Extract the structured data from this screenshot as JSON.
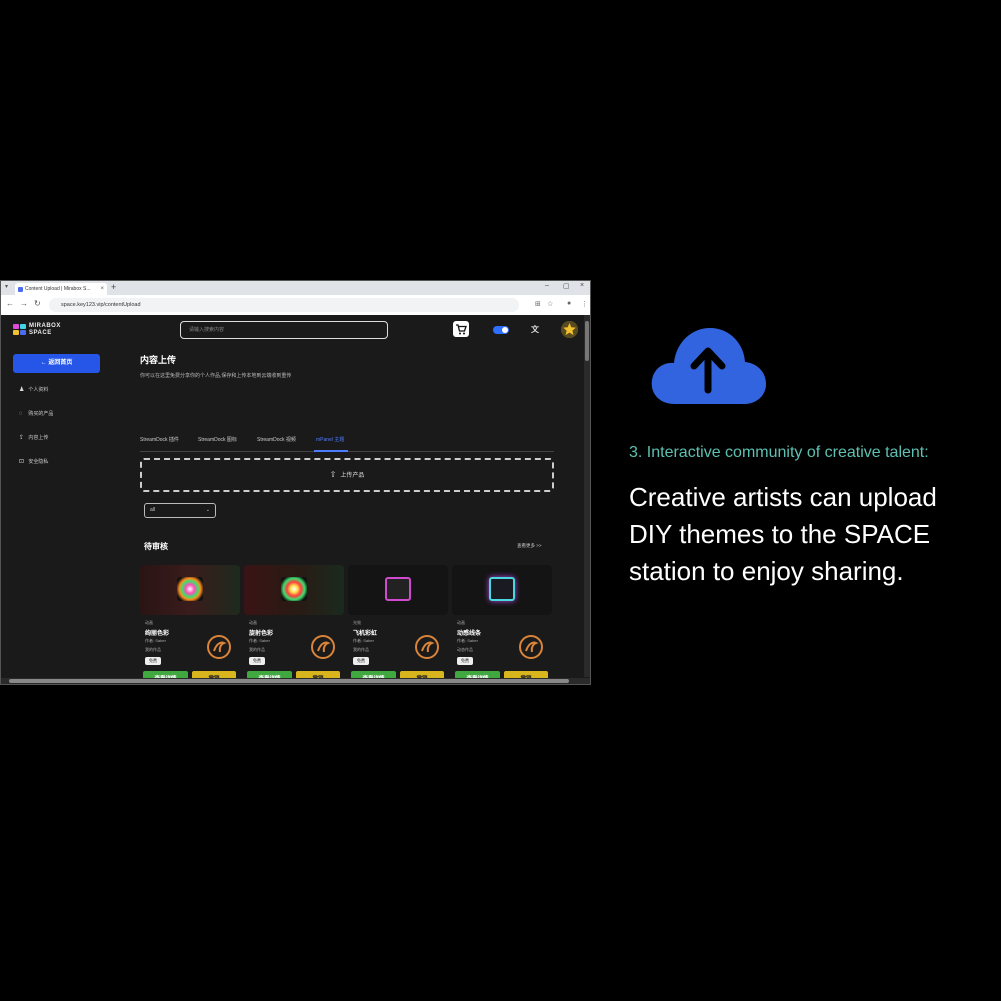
{
  "browser": {
    "tab_title": "Content Upload | Mirabox S...",
    "tab_close": "×",
    "new_tab": "+",
    "url": "space.key123.vip/contentUpload",
    "window_controls": [
      "–",
      "▢",
      "×"
    ]
  },
  "app": {
    "logo_line1": "MIRABOX",
    "logo_line2": "SPACE",
    "search_placeholder": "请输入搜索内容",
    "lang_label": "文",
    "sidebar": {
      "back_label": "←  返回首页",
      "items": [
        {
          "icon": "user-icon",
          "label": "个人资料"
        },
        {
          "icon": "bag-icon",
          "label": "购买的产品"
        },
        {
          "icon": "upload-icon",
          "label": "内容上传"
        },
        {
          "icon": "lock-icon",
          "label": "安全隐私"
        }
      ]
    },
    "main": {
      "title": "内容上传",
      "description": "你可以在这里免费分享你的个人作品,保存和上传本地到云端收到重传",
      "tabs": [
        {
          "label": "StreamDock 插件",
          "active": false
        },
        {
          "label": "StreamDock 图标",
          "active": false
        },
        {
          "label": "StreamDock 视频",
          "active": false
        },
        {
          "label": "mPanel 主题",
          "active": true
        }
      ],
      "upload_label": "上传产品",
      "filter_value": "all",
      "pending_title": "待审核",
      "view_more": "查看更多 >>",
      "cards": [
        {
          "category": "动画",
          "name": "绚丽色彩",
          "author": "作者: Saber",
          "meta": "我的作品",
          "badge": "免费",
          "detail_label": "查看详情",
          "revoke_label": "撤销"
        },
        {
          "category": "动画",
          "name": "旋射色彩",
          "author": "作者: Saber",
          "meta": "我的作品",
          "badge": "免费",
          "detail_label": "查看详情",
          "revoke_label": "撤销"
        },
        {
          "category": "光效",
          "name": "飞机彩虹",
          "author": "作者: Saber",
          "meta": "我的作品",
          "badge": "免费",
          "detail_label": "查看详情",
          "revoke_label": "撤销"
        },
        {
          "category": "动画",
          "name": "动感线条",
          "author": "作者: Saber",
          "meta": "动态作品",
          "badge": "免费",
          "detail_label": "查看详情",
          "revoke_label": "撤销"
        }
      ]
    }
  },
  "promo": {
    "icon": "cloud-upload-icon",
    "caption_small": "3. Interactive community of creative talent:",
    "caption_large": "Creative artists can upload DIY themes to the SPACE station to enjoy sharing."
  },
  "colors": {
    "accent_blue": "#2556e8",
    "cloud_blue": "#3264e0",
    "caption_teal": "#5ec0b2",
    "detail_green": "#3fa83f",
    "revoke_yellow": "#d8b51c"
  }
}
